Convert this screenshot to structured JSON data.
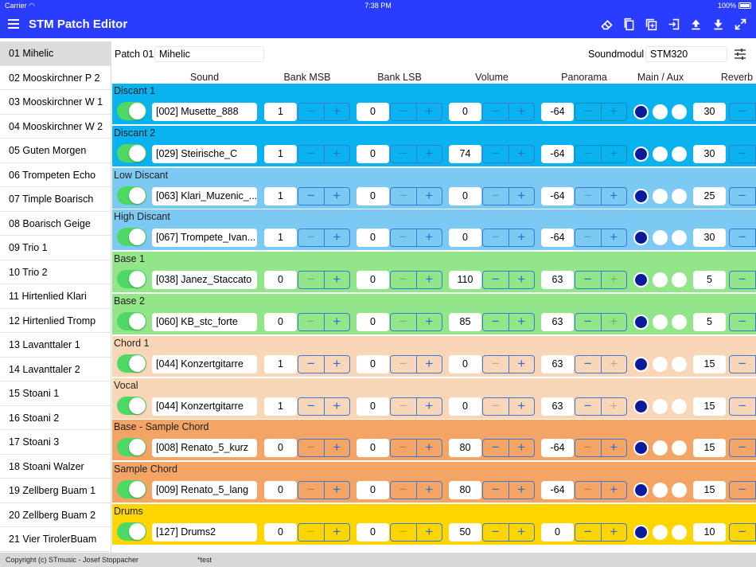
{
  "status_bar": {
    "carrier": "Carrier",
    "time": "7:38 PM",
    "battery": "100%"
  },
  "app": {
    "title": "STM Patch Editor"
  },
  "toolbar_icons": [
    "eraser-icon",
    "copy-icon",
    "duplicate-icon",
    "import-icon",
    "upload-icon",
    "download-icon",
    "expand-icon"
  ],
  "sidebar": {
    "items": [
      "01 Mihelic",
      "02 Mooskirchner P 2",
      "03 Mooskirchner W 1",
      "04 Mooskirchner W 2",
      "05 Guten Morgen",
      "06 Trompeten Echo",
      "07 Timple Boarisch",
      "08 Boarisch Geige",
      "09 Trio 1",
      "10 Trio 2",
      "11 Hirtenlied Klari",
      "12 Hirtenlied Tromp",
      "13 Lavanttaler 1",
      "14 Lavanttaler 2",
      "15 Stoani 1",
      "16 Stoani 2",
      "17 Stoani 3",
      "18 Stoani Walzer",
      "19 Zellberg Buam 1",
      "20 Zellberg Buam 2",
      "21 Vier TirolerBuam"
    ],
    "active_index": 0
  },
  "patch": {
    "label": "Patch 01",
    "name": "Mihelic",
    "soundmodul_label": "Soundmodul",
    "soundmodul_value": "STM320"
  },
  "columns": {
    "sound": "Sound",
    "bank_msb": "Bank MSB",
    "bank_lsb": "Bank LSB",
    "volume": "Volume",
    "panorama": "Panorama",
    "main_aux": "Main / Aux",
    "reverb": "Reverb"
  },
  "colors": {
    "accent": "#2a3dff",
    "switch_on": "#4cd964",
    "selected_dot": "#0c1a9c"
  },
  "rows": [
    {
      "title": "Discant 1",
      "color": "#0ab2f0",
      "sound": "[002] Musette_888",
      "msb": "1",
      "lsb": "0",
      "volume": "0",
      "pan": "-64",
      "reverb": "30",
      "steppers": [
        [
          0,
          1
        ],
        [
          0,
          1
        ],
        [
          0,
          1
        ],
        [
          0,
          0
        ]
      ]
    },
    {
      "title": "Discant 2",
      "color": "#0ab2f0",
      "sound": "[029] Steirische_C",
      "msb": "1",
      "lsb": "0",
      "volume": "74",
      "pan": "-64",
      "reverb": "30",
      "steppers": [
        [
          0,
          1
        ],
        [
          0,
          1
        ],
        [
          0,
          1
        ],
        [
          0,
          0
        ]
      ]
    },
    {
      "title": "Low Discant",
      "color": "#7ccaf4",
      "sound": "[063] Klari_Muzenic_...",
      "msb": "1",
      "lsb": "0",
      "volume": "0",
      "pan": "-64",
      "reverb": "25",
      "steppers": [
        [
          1,
          1
        ],
        [
          0,
          1
        ],
        [
          0,
          1
        ],
        [
          0,
          1
        ]
      ]
    },
    {
      "title": "High Discant",
      "color": "#7ccaf4",
      "sound": "[067] Trompete_Ivan...",
      "msb": "1",
      "lsb": "0",
      "volume": "0",
      "pan": "-64",
      "reverb": "30",
      "steppers": [
        [
          0,
          1
        ],
        [
          0,
          1
        ],
        [
          0,
          1
        ],
        [
          0,
          1
        ]
      ]
    },
    {
      "title": "Base 1",
      "color": "#93e58a",
      "sound": "[038] Janez_Staccato",
      "msb": "0",
      "lsb": "0",
      "volume": "110",
      "pan": "63",
      "reverb": "5",
      "steppers": [
        [
          0,
          1
        ],
        [
          0,
          1
        ],
        [
          1,
          1
        ],
        [
          1,
          0
        ]
      ]
    },
    {
      "title": "Base 2",
      "color": "#93e58a",
      "sound": "[060] KB_stc_forte",
      "msb": "0",
      "lsb": "0",
      "volume": "85",
      "pan": "63",
      "reverb": "5",
      "steppers": [
        [
          0,
          1
        ],
        [
          0,
          1
        ],
        [
          1,
          1
        ],
        [
          1,
          0
        ]
      ]
    },
    {
      "title": "Chord 1",
      "color": "#f9d6b7",
      "sound": "[044] Konzertgitarre",
      "msb": "1",
      "lsb": "0",
      "volume": "0",
      "pan": "63",
      "reverb": "15",
      "steppers": [
        [
          1,
          1
        ],
        [
          0,
          1
        ],
        [
          0,
          1
        ],
        [
          1,
          0
        ]
      ]
    },
    {
      "title": "Vocal",
      "color": "#f9d6b7",
      "sound": "[044] Konzertgitarre",
      "msb": "1",
      "lsb": "0",
      "volume": "0",
      "pan": "63",
      "reverb": "15",
      "steppers": [
        [
          1,
          1
        ],
        [
          0,
          1
        ],
        [
          0,
          1
        ],
        [
          1,
          0
        ]
      ]
    },
    {
      "title": "Base - Sample Chord",
      "color": "#f4a464",
      "sound": "[008] Renato_5_kurz",
      "msb": "0",
      "lsb": "0",
      "volume": "80",
      "pan": "-64",
      "reverb": "15",
      "steppers": [
        [
          0,
          1
        ],
        [
          0,
          1
        ],
        [
          1,
          1
        ],
        [
          0,
          1
        ]
      ]
    },
    {
      "title": "Sample Chord",
      "color": "#f4a464",
      "sound": "[009] Renato_5_lang",
      "msb": "0",
      "lsb": "0",
      "volume": "80",
      "pan": "-64",
      "reverb": "15",
      "steppers": [
        [
          0,
          1
        ],
        [
          0,
          1
        ],
        [
          1,
          1
        ],
        [
          0,
          1
        ]
      ]
    },
    {
      "title": "Drums",
      "color": "#ffd500",
      "sound": "[127] Drums2",
      "msb": "0",
      "lsb": "0",
      "volume": "50",
      "pan": "0",
      "reverb": "10",
      "steppers": [
        [
          0,
          1
        ],
        [
          0,
          1
        ],
        [
          1,
          1
        ],
        [
          1,
          1
        ]
      ]
    }
  ],
  "footer": {
    "copyright": "Copyright (c) STmusic - Josef Stoppacher",
    "note": "*test"
  }
}
